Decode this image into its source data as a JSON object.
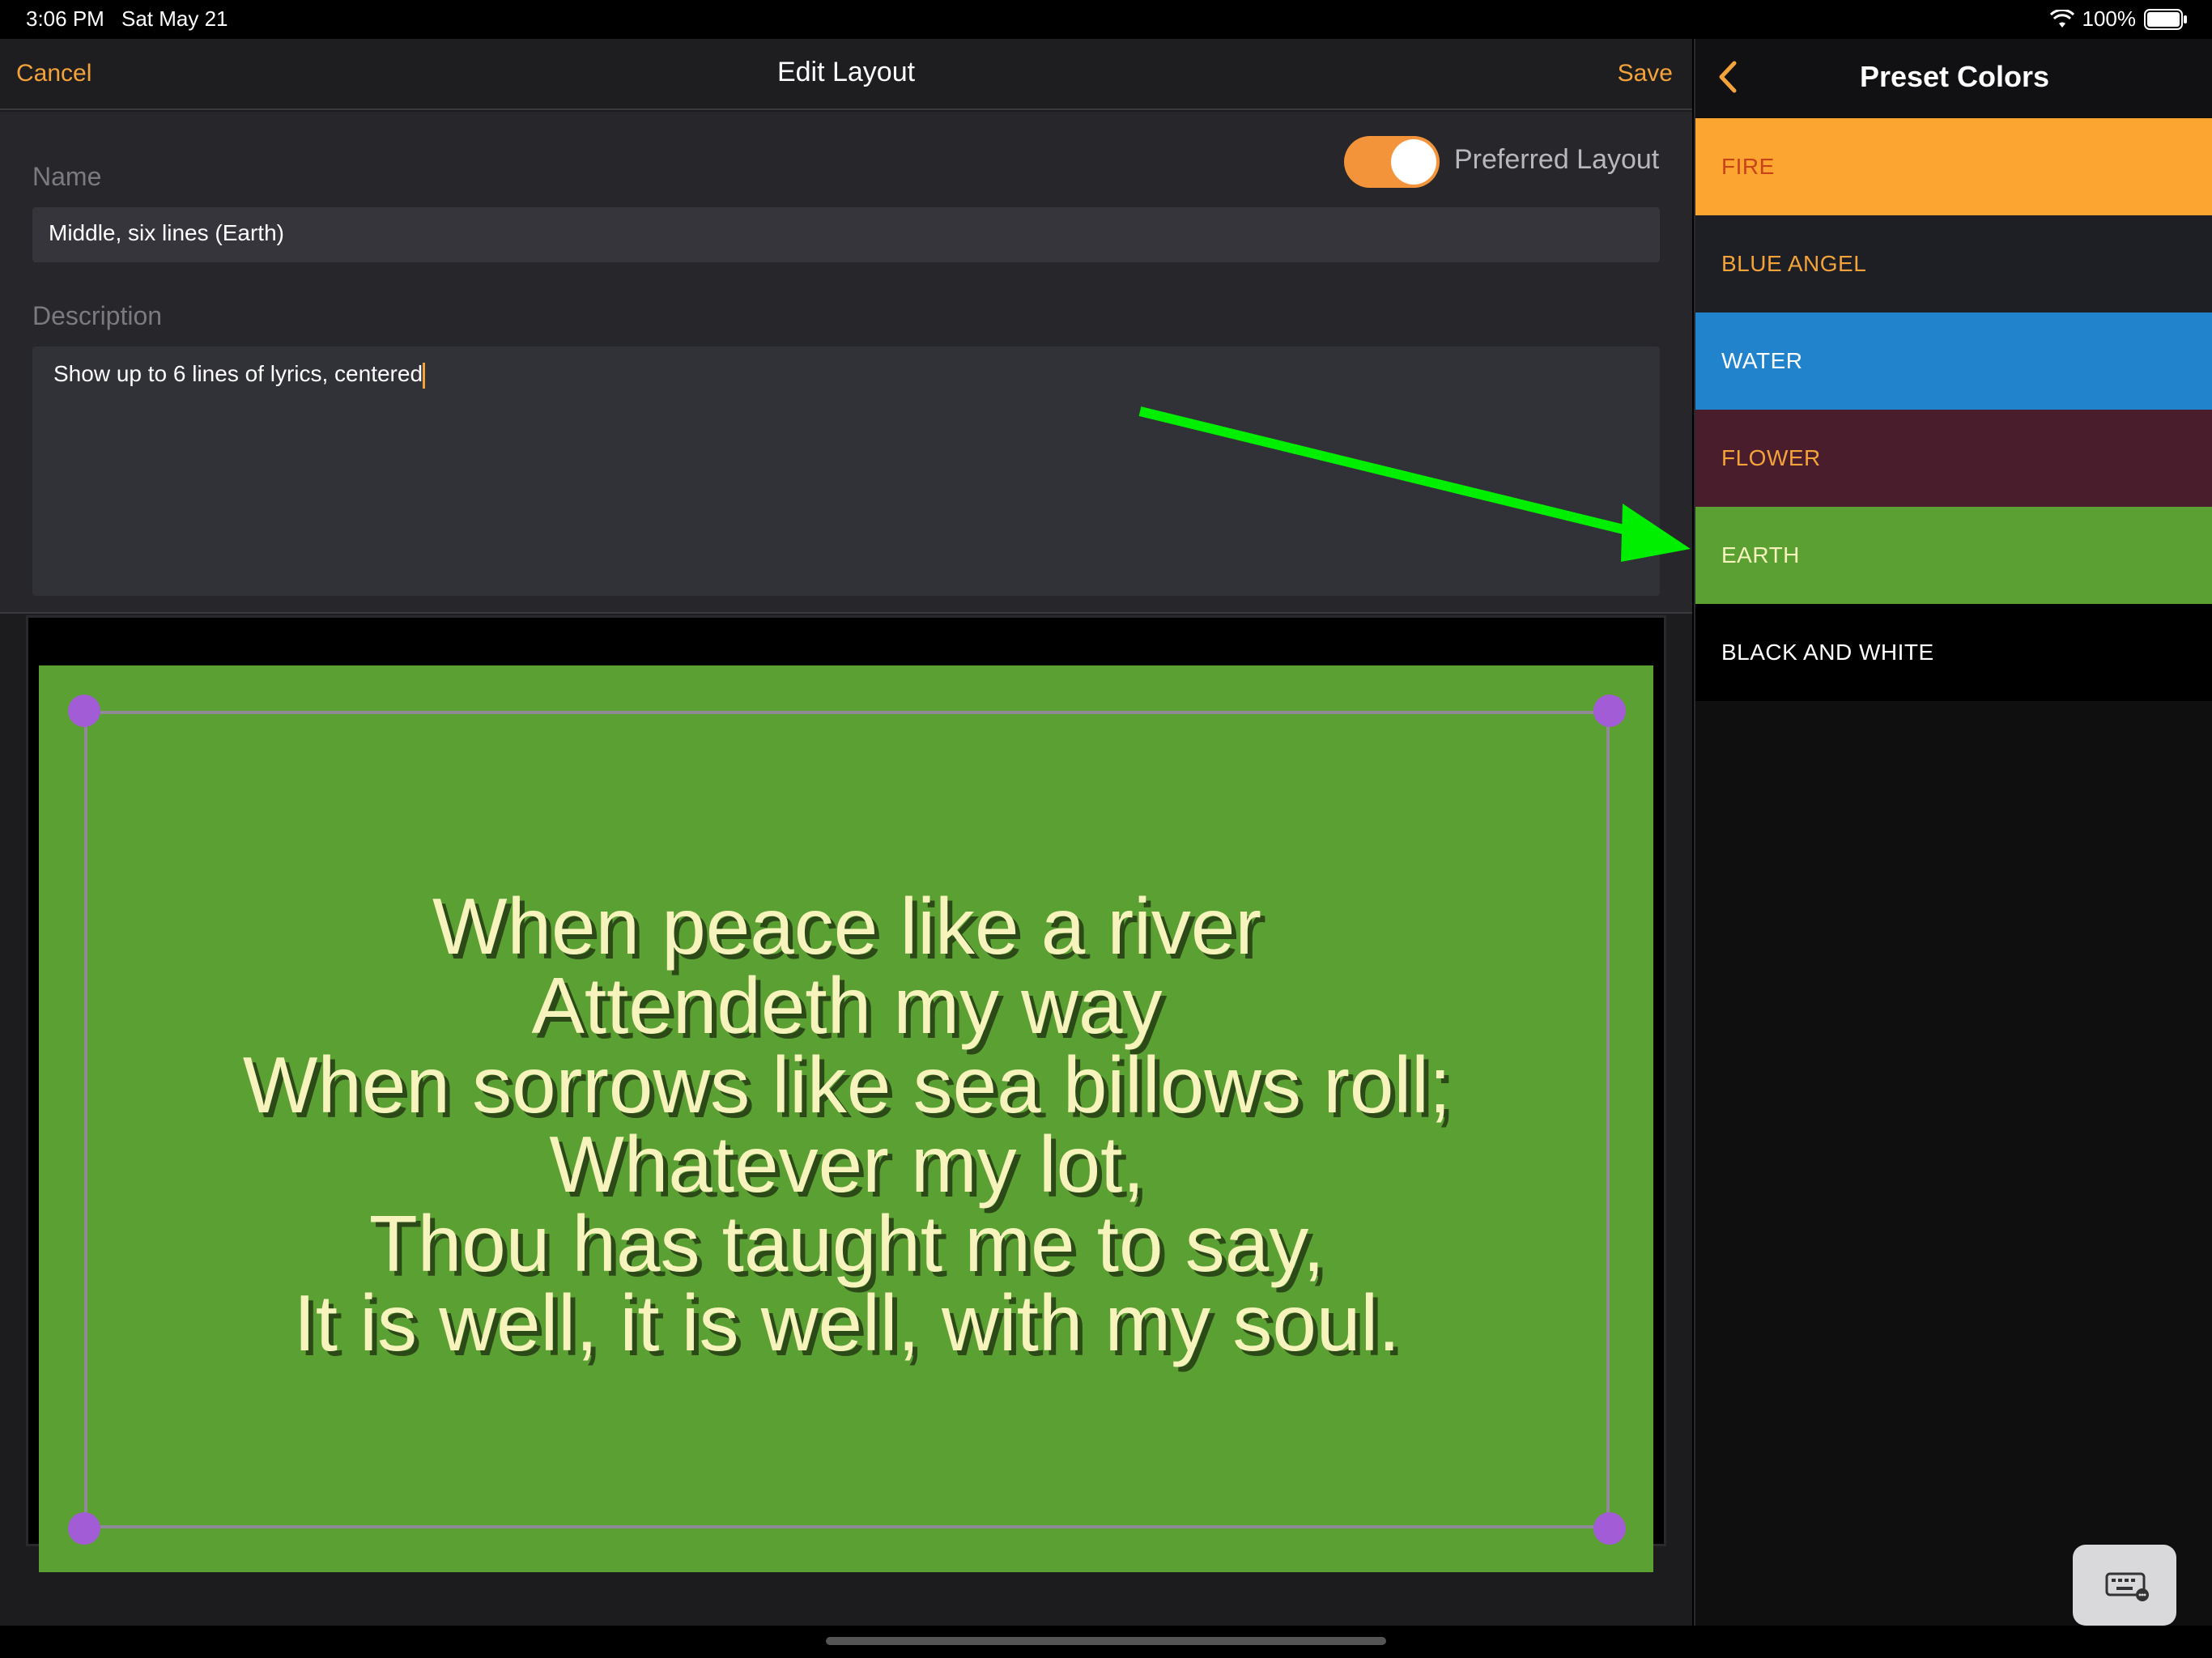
{
  "status_bar": {
    "time": "3:06 PM",
    "date": "Sat May 21",
    "battery": "100%"
  },
  "nav": {
    "cancel_label": "Cancel",
    "title": "Edit Layout",
    "save_label": "Save"
  },
  "form": {
    "preferred_layout_label": "Preferred Layout",
    "preferred_layout_on": true,
    "name_label": "Name",
    "name_value": "Middle, six lines (Earth)",
    "description_label": "Description",
    "description_value": "Show up to 6 lines of lyrics, centered"
  },
  "preview": {
    "lyrics": [
      "When peace like a river",
      "Attendeth my way",
      "When sorrows like sea billows roll;",
      "Whatever my lot,",
      "Thou has taught me to say,",
      "It is well, it is well, with my soul."
    ]
  },
  "preset_panel": {
    "title": "Preset Colors",
    "back_icon": "chevron-left-icon",
    "presets": [
      {
        "label": "FIRE",
        "bg": "#fca530",
        "fg": "#c8421a"
      },
      {
        "label": "BLUE ANGEL",
        "bg": "#1e1f24",
        "fg": "#f4a23a"
      },
      {
        "label": "WATER",
        "bg": "#2183cc",
        "fg": "#ffffff"
      },
      {
        "label": "FLOWER",
        "bg": "#4a1d2d",
        "fg": "#f4a23a"
      },
      {
        "label": "EARTH",
        "bg": "#5ba032",
        "fg": "#f7f3bd"
      },
      {
        "label": "BLACK AND WHITE",
        "bg": "#000000",
        "fg": "#ffffff"
      }
    ]
  },
  "colors": {
    "accent": "#f4a23a",
    "annotation_arrow": "#00ee00",
    "handle": "#a25cd6"
  },
  "icons": {
    "keyboard": "keyboard-icon",
    "wifi": "wifi-icon",
    "battery": "battery-icon"
  }
}
